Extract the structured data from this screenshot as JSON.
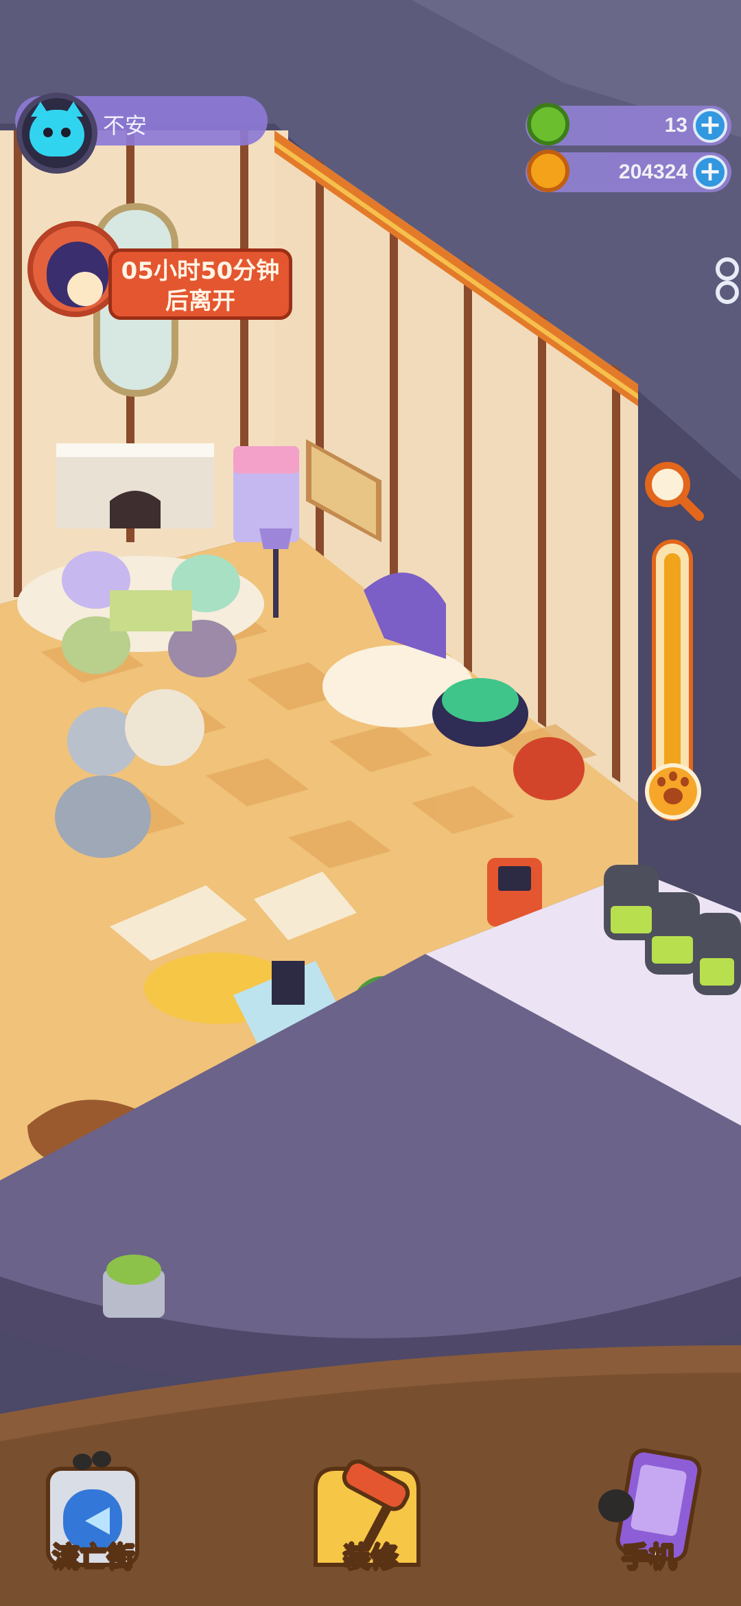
{
  "player": {
    "name": "不安",
    "avatar_icon": "cyan-cat-avatar-icon"
  },
  "currencies": [
    {
      "icon": "green-gem-icon",
      "value": "13",
      "color": "#6bbf2f"
    },
    {
      "icon": "orange-planet-coin-icon",
      "value": "204324",
      "color": "#f4a21a"
    }
  ],
  "visitor": {
    "timer_line1": "05小时50分钟",
    "timer_line2": "后离开"
  },
  "zoom": {
    "icon": "magnifier-icon",
    "level": 0.95,
    "thumb_icon": "paw-icon"
  },
  "dock": {
    "street_label": "流亡街",
    "decorate_label": "装修",
    "phone_label": "手机"
  },
  "colors": {
    "wall": "#f3dfc0",
    "floor_tile_a": "#f0c27a",
    "floor_tile_b": "#e9a955",
    "platform": "#6b6389",
    "dirt": "#8a5c3a",
    "accent_orange": "#e4562f"
  }
}
